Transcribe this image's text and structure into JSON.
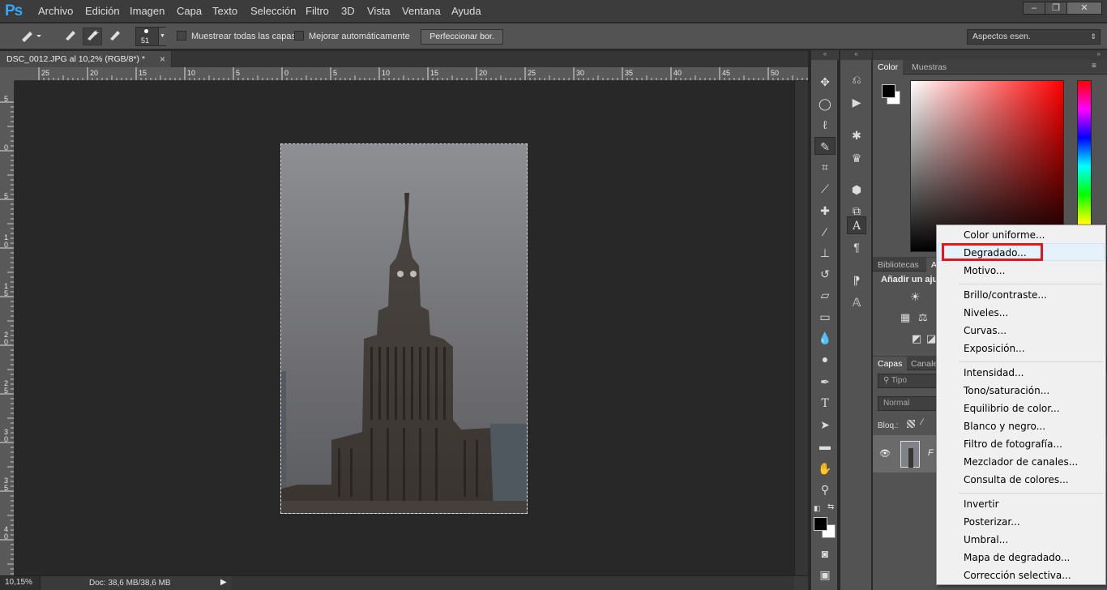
{
  "menubar": {
    "logo": "Ps",
    "items": [
      "Archivo",
      "Edición",
      "Imagen",
      "Capa",
      "Texto",
      "Selección",
      "Filtro",
      "3D",
      "Vista",
      "Ventana",
      "Ayuda"
    ],
    "window_buttons": [
      "–",
      "❐",
      "✕"
    ]
  },
  "options": {
    "brush_size": "51",
    "sample_all_label": "Muestrear todas las capas",
    "auto_enhance_label": "Mejorar automáticamente",
    "refine_edge_label": "Perfeccionar bor.",
    "workspace": "Aspectos esen."
  },
  "document": {
    "tab_title": "DSC_0012.JPG al 10,2% (RGB/8*) *",
    "close_glyph": "×"
  },
  "ruler": {
    "h_ticks": [
      "25",
      "20",
      "15",
      "10",
      "5",
      "0",
      "5",
      "10",
      "15",
      "20",
      "25",
      "30",
      "35",
      "40",
      "45",
      "50"
    ],
    "v_ticks": [
      "5",
      "0",
      "5",
      "1\n0",
      "1\n5",
      "2\n0",
      "2\n5",
      "3\n0",
      "3\n5",
      "4\n0"
    ]
  },
  "status": {
    "zoom": "10,15%",
    "doc_size": "Doc: 38,6 MB/38,6 MB"
  },
  "panels": {
    "color_tab": "Color",
    "swatches_tab": "Muestras",
    "libraries_tab": "Bibliotecas",
    "adjust_tab_fragment": "A",
    "adjust_heading": "Añadir un aju",
    "layers_tab": "Capas",
    "channels_tab": "Canale",
    "search_placeholder": "Tipo",
    "blend_mode": "Normal",
    "lock_label": "Bloq.:",
    "layer_name_fragment": "F"
  },
  "context_menu": {
    "groups": [
      [
        "Color uniforme...",
        "Degradado...",
        "Motivo..."
      ],
      [
        "Brillo/contraste...",
        "Niveles...",
        "Curvas...",
        "Exposición..."
      ],
      [
        "Intensidad...",
        "Tono/saturación...",
        "Equilibrio de color...",
        "Blanco y negro...",
        "Filtro de fotografía...",
        "Mezclador de canales...",
        "Consulta de colores..."
      ],
      [
        "Invertir",
        "Posterizar...",
        "Umbral...",
        "Mapa de degradado...",
        "Corrección selectiva..."
      ]
    ],
    "highlighted": "Degradado..."
  },
  "colors": {
    "highlight_border": "#e2161b",
    "foreground": "#000000",
    "background": "#ffffff"
  }
}
